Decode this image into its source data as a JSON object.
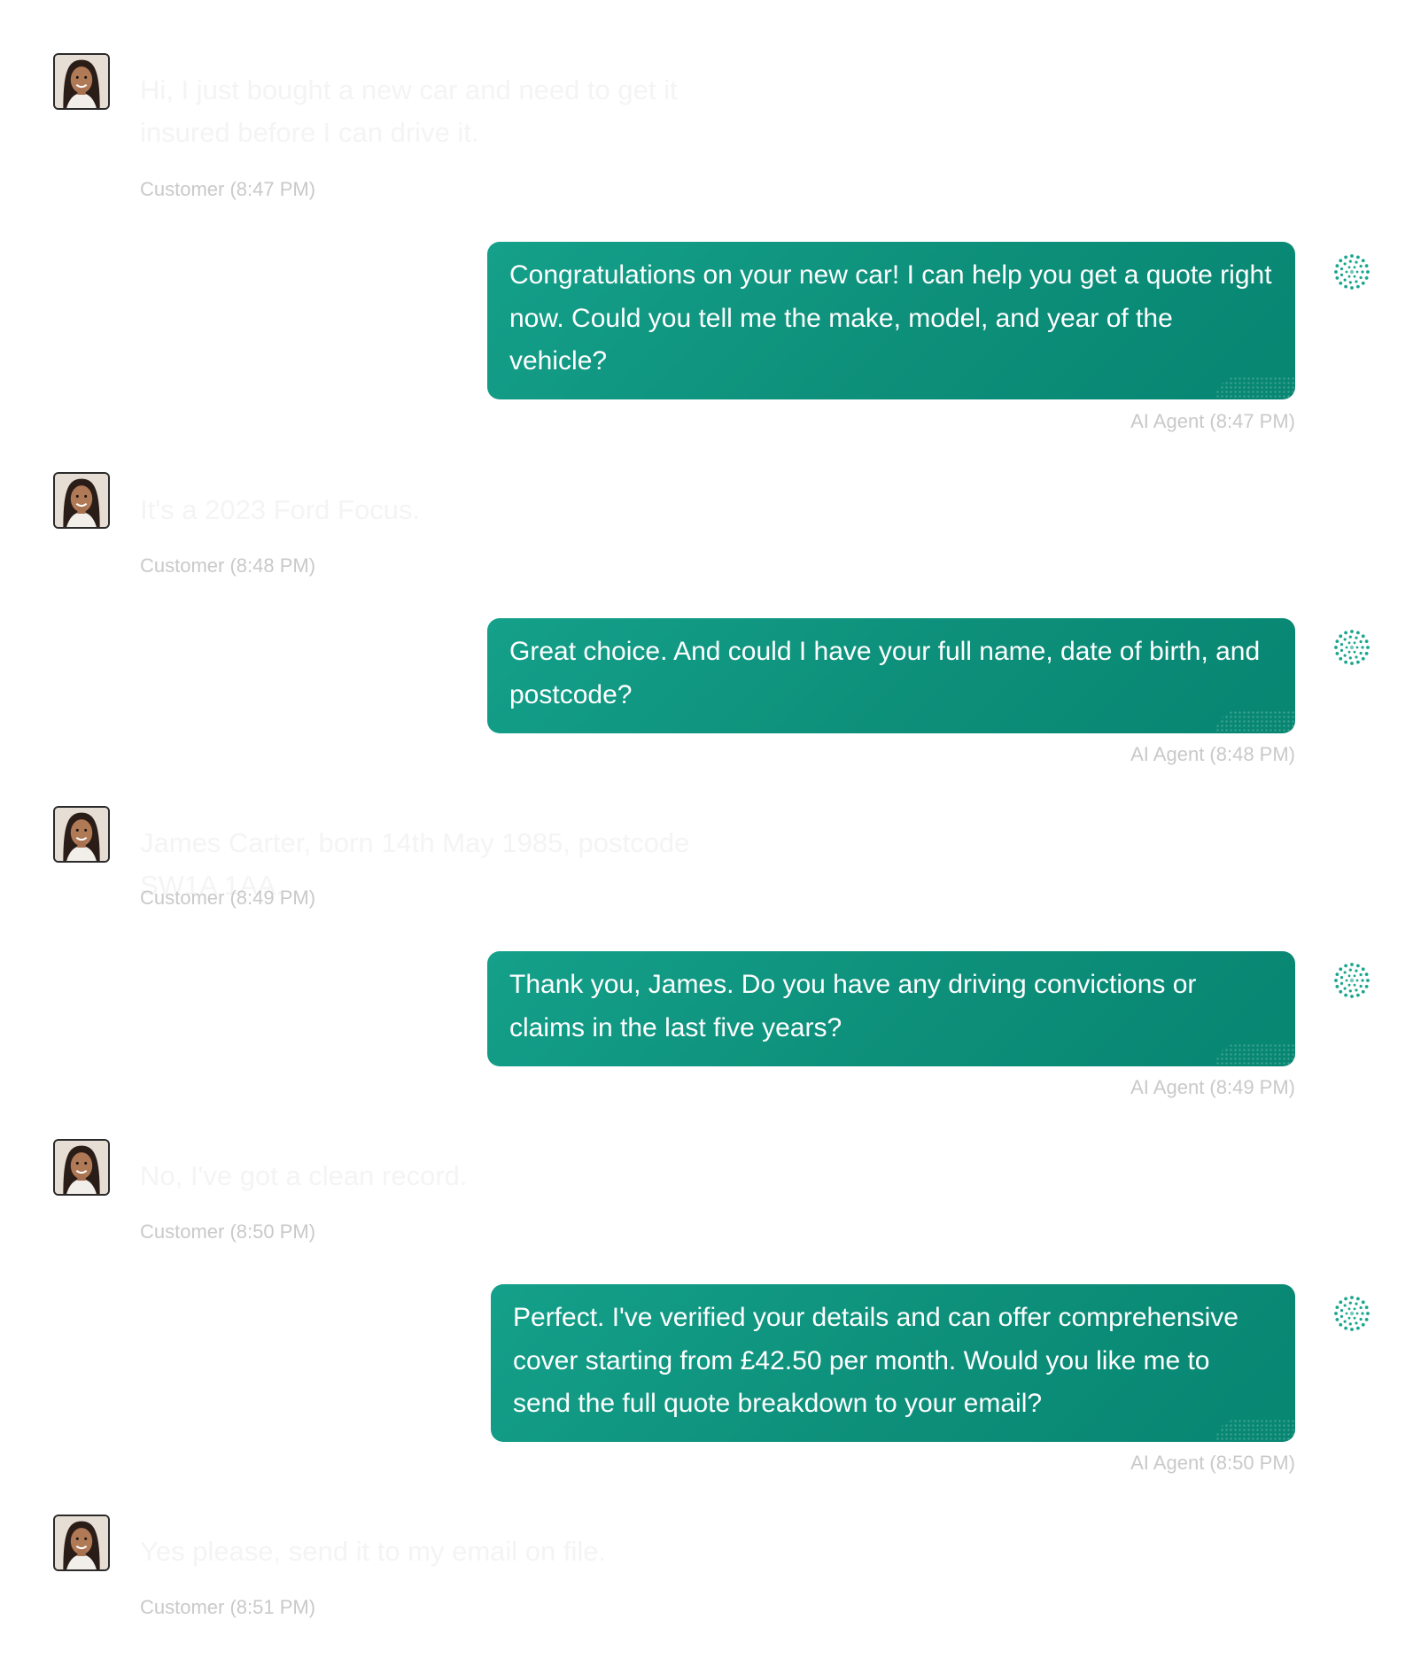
{
  "colors": {
    "agent_bubble": "#0d8f7a",
    "agent_icon": "#1aa58d",
    "timestamp": "#c9c9c9",
    "customer_text_faded": "#f4f4f4"
  },
  "messages": [
    {
      "role": "customer",
      "lines": [
        "Hi, I just bought a new car and need to get it",
        "insured before I can drive it."
      ],
      "meta": "Customer (8:47 PM)",
      "icon": "customer-avatar"
    },
    {
      "role": "agent",
      "text": "Congratulations on your new car! I can help you get a quote right now. Could you tell me the make, model, and year of the vehicle?",
      "meta": "AI Agent (8:47 PM)",
      "icon": "ai-agent-dots-icon"
    },
    {
      "role": "customer",
      "lines": [
        "It's a 2023 Ford Focus."
      ],
      "meta": "Customer (8:48 PM)",
      "icon": "customer-avatar"
    },
    {
      "role": "agent",
      "text": "Great choice. And could I have your full name, date of birth, and postcode?",
      "meta": "AI Agent (8:48 PM)",
      "icon": "ai-agent-dots-icon"
    },
    {
      "role": "customer",
      "lines": [
        "James Carter, born 14th May 1985, postcode SW1A 1AA."
      ],
      "meta": "Customer (8:49 PM)",
      "icon": "customer-avatar"
    },
    {
      "role": "agent",
      "text": "Thank you, James. Do you have any driving convictions or claims in the last five years?",
      "meta": "AI Agent (8:49 PM)",
      "icon": "ai-agent-dots-icon"
    },
    {
      "role": "customer",
      "lines": [
        "No, I've got a clean record."
      ],
      "meta": "Customer (8:50 PM)",
      "icon": "customer-avatar"
    },
    {
      "role": "agent",
      "text": "Perfect. I've verified your details and can offer comprehensive cover starting from £42.50 per month. Would you like me to send the full quote breakdown to your email?",
      "meta": "AI Agent (8:50 PM)",
      "icon": "ai-agent-dots-icon"
    },
    {
      "role": "customer",
      "lines": [
        "Yes please, send it to my email on file."
      ],
      "meta": "Customer (8:51 PM)",
      "icon": "customer-avatar"
    }
  ]
}
